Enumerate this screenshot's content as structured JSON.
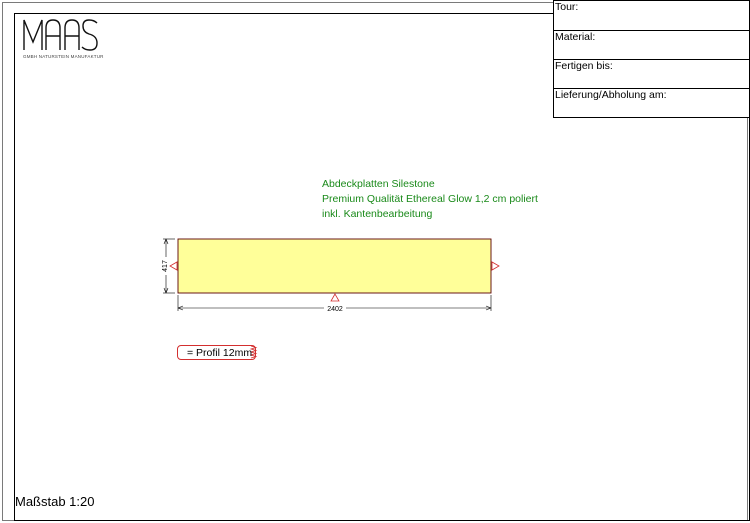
{
  "logo": {
    "brand": "MAAS",
    "subtitle": "GMBH NATURSTEIN MANUFAKTUR"
  },
  "info_table": {
    "rows": [
      {
        "label": "Tour:"
      },
      {
        "label": "Material:"
      },
      {
        "label": "Fertigen bis:"
      },
      {
        "label": "Lieferung/Abholung am:"
      }
    ]
  },
  "description": {
    "line1": "Abdeckplatten Silestone",
    "line2": "Premium Qualität Ethereal Glow 1,2 cm poliert",
    "line3": "inkl. Kantenbearbeitung"
  },
  "plate": {
    "width_label": "2402",
    "height_label": "417",
    "fill_color": "#ffff99",
    "edge_color": "#d32f2f"
  },
  "profile": {
    "label": "= Profil 12mm"
  },
  "scale": {
    "label": "Maßstab 1:20"
  },
  "colors": {
    "text_green": "#1a8a1a",
    "accent_red": "#d32f2f"
  }
}
